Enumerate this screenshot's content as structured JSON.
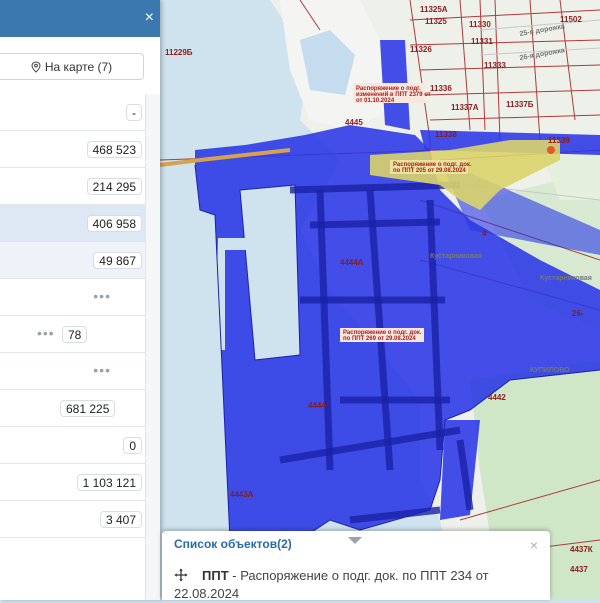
{
  "panel": {
    "close_icon": "×",
    "on_map_button": "На карте (7)",
    "rows": [
      {
        "value": "-"
      },
      {
        "value": "468 523"
      },
      {
        "value": "214 295"
      },
      {
        "value": "406 958"
      },
      {
        "value": "49 867"
      },
      {
        "value": "•••"
      },
      {
        "dots": "•••",
        "value": "78"
      },
      {
        "value": "•••"
      },
      {
        "value": "681 225"
      },
      {
        "value": "0"
      },
      {
        "value": "1 103 121"
      },
      {
        "value": "3 407"
      }
    ]
  },
  "map": {
    "labels": {
      "l11325a": "11325А",
      "l11325": "11325",
      "l11330": "11330",
      "l11331": "11331",
      "l11326": "11326",
      "l11333": "11333",
      "l11336": "11336",
      "l11337a": "11337А",
      "l11337b": "11337Б",
      "l11338": "11338",
      "l11339": "11339",
      "l11502": "11502",
      "l11229b": "11229Б",
      "l4445": "4445",
      "l4444a": "4444А",
      "l4444": "4444",
      "l4443a": "4443А",
      "l4442": "4442",
      "l4437k": "4437К",
      "l4437": "4437",
      "l26": "26-",
      "road1": "25-я дорожка",
      "road2": "26-я дорожка",
      "road3": "Кустарниковая",
      "road4": "Кустарниковая",
      "road5": "КУПИЛОВО",
      "ann1_l1": "Распоряжение о подг.",
      "ann1_l2": "изменений в ППТ 2379 от",
      "ann1_l3": "от 01.10.2024",
      "ann2_l1": "Распоряжение о подг. док.",
      "ann2_l2": "по ППТ 205 от 29.08.2024",
      "ann3_l1": "Распоряжение о подг. док.",
      "ann3_l2": "по ППТ 269 от 29.08.2024",
      "ann4": "4"
    }
  },
  "popup": {
    "title": "Список объектов(2)",
    "close_icon": "×",
    "item_label": "ППТ",
    "item_text": " - Распоряжение о подг. док. по ППТ 234 от 22.08.2024"
  },
  "colors": {
    "water": "#cfe3ef",
    "zone_fill": "#2a37e6",
    "zone_yellow": "#d9d36a",
    "parcel_line": "#b03a3a",
    "header": "#3a78ae"
  }
}
